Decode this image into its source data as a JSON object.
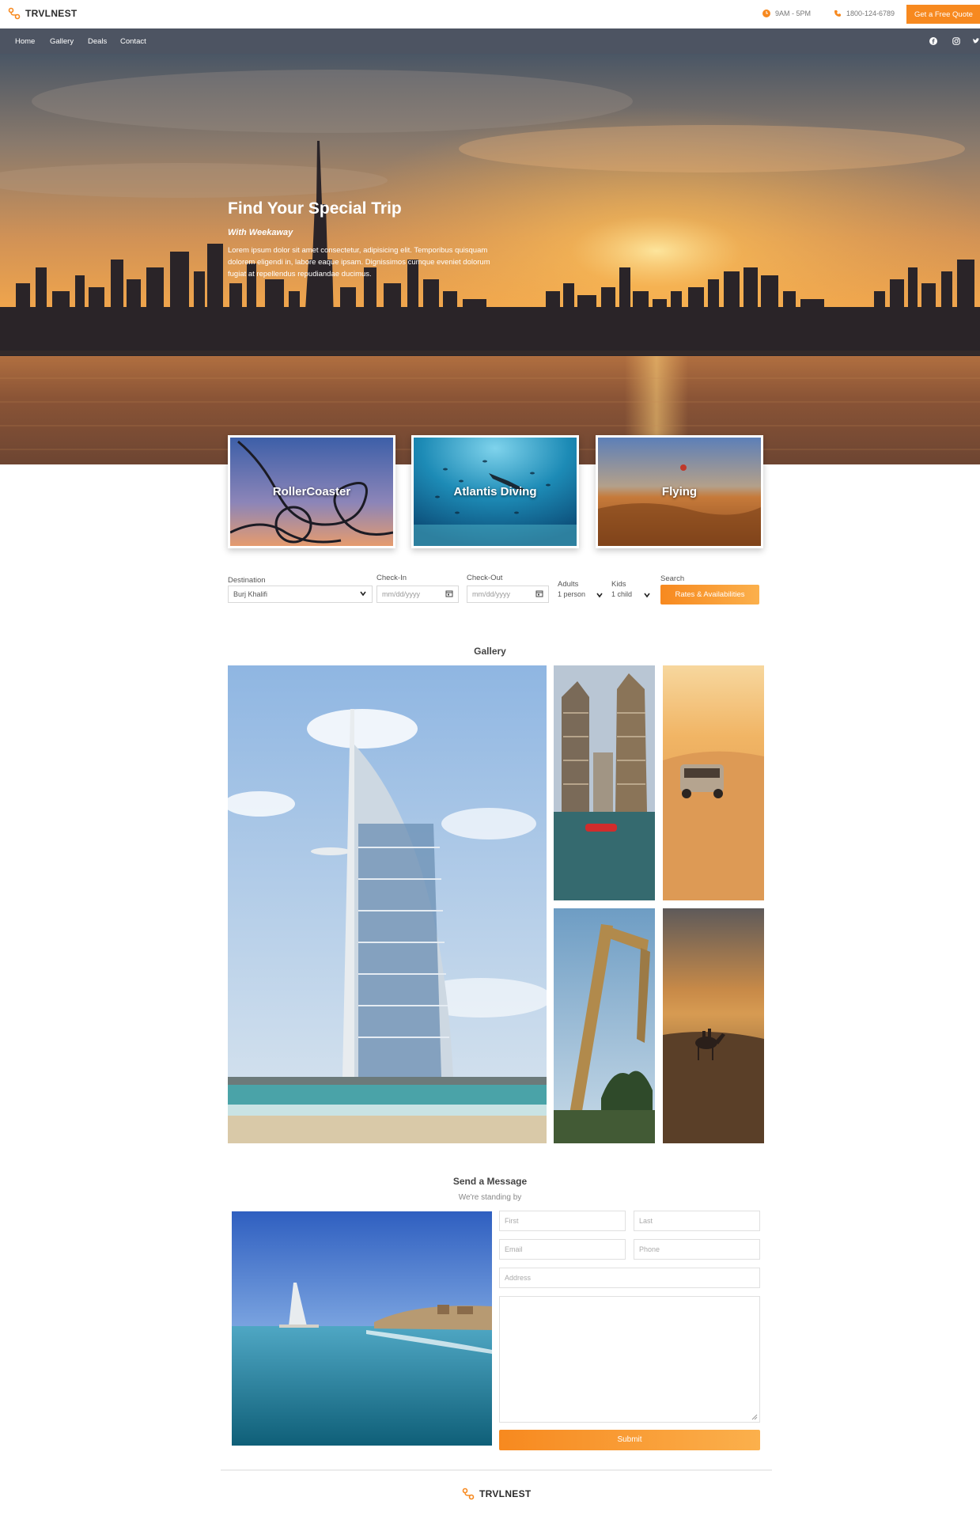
{
  "brand": {
    "name": "TRVLNEST",
    "color": "#f7891f"
  },
  "header": {
    "hours": "9AM - 5PM",
    "phone": "1800-124-6789",
    "quote_button": "Get a Free Quote"
  },
  "nav": {
    "items": [
      "Home",
      "Gallery",
      "Deals",
      "Contact"
    ],
    "social_icons": [
      "facebook-icon",
      "instagram-icon",
      "twitter-icon"
    ]
  },
  "hero": {
    "title": "Find Your Special Trip",
    "subtitle": "With Weekaway",
    "body": "Lorem ipsum dolor sit amet consectetur, adipisicing elit. Temporibus quisquam dolorem eligendi in, labore eaque ipsam. Dignissimos cumque eveniet dolorum fugiat at repellendus repudiandae ducimus."
  },
  "activities": [
    {
      "label": "RollerCoaster"
    },
    {
      "label": "Atlantis Diving"
    },
    {
      "label": "Flying"
    }
  ],
  "search": {
    "destination_label": "Destination",
    "destination_value": "Burj Khalifi",
    "checkin_label": "Check-In",
    "checkin_placeholder": "mm/dd/yyyy",
    "checkout_label": "Check-Out",
    "checkout_placeholder": "mm/dd/yyyy",
    "adults_label": "Adults",
    "adults_value": "1 person",
    "kids_label": "Kids",
    "kids_value": "1 child",
    "search_label": "Search",
    "button": "Rates & Availabilities"
  },
  "gallery": {
    "title": "Gallery"
  },
  "contact": {
    "title": "Send a Message",
    "subtitle": "We're standing by",
    "first_placeholder": "First",
    "last_placeholder": "Last",
    "email_placeholder": "Email",
    "phone_placeholder": "Phone",
    "address_placeholder": "Address",
    "submit": "Submit"
  },
  "footer": {
    "brand": "TRVLNEST"
  }
}
